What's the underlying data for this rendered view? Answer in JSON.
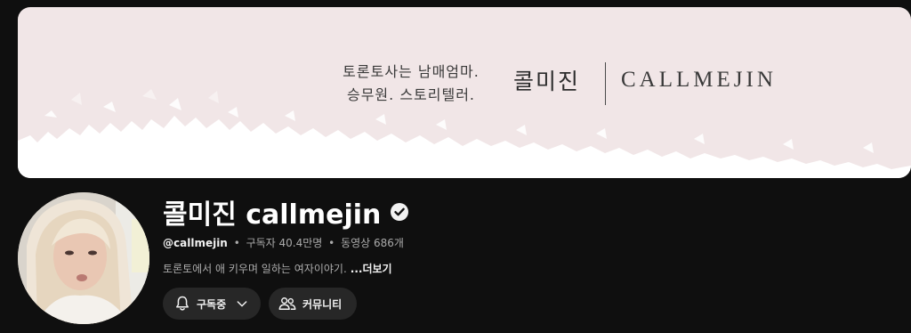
{
  "banner": {
    "tagline_line1": "토론토사는 남매엄마.",
    "tagline_line2": "승무원. 스토리텔러.",
    "logo_korean": "콜미진",
    "logo_english": "CALLMEJIN",
    "background_color": "#f1e6e7"
  },
  "channel": {
    "name": "콜미진 callmejin",
    "verified_icon": "verified-check-icon",
    "handle": "@callmejin",
    "separator": "•",
    "subscribers": "구독자 40.4만명",
    "videos": "동영상 686개",
    "description": "토론토에서 애 키우며 일하는 여자이야기.",
    "more_label": "...더보기"
  },
  "actions": {
    "subscribe": {
      "label": "구독중",
      "icon": "bell-icon",
      "dropdown_icon": "chevron-down-icon"
    },
    "community": {
      "label": "커뮤니티",
      "icon": "people-icon"
    }
  },
  "colors": {
    "page_background": "#0f0f0f",
    "button_background": "#272727",
    "secondary_text": "#aaaaaa"
  }
}
